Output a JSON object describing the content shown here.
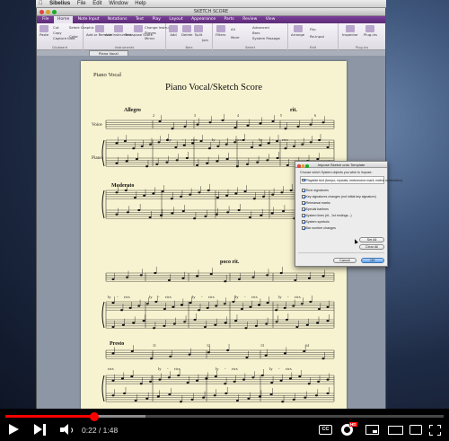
{
  "mac_menubar": {
    "apple": "",
    "items": [
      "Sibelius",
      "File",
      "Edit",
      "Window",
      "Help"
    ]
  },
  "window": {
    "title": "SKETCH SCORE"
  },
  "ribbon": {
    "tabs": [
      "File",
      "Home",
      "Note Input",
      "Notations",
      "Text",
      "Play",
      "Layout",
      "Appearance",
      "Parts",
      "Review",
      "View"
    ],
    "active_tab": "Home",
    "groups": [
      {
        "label": "Clipboard",
        "buttons": [
          "Paste",
          "Cut",
          "Copy",
          "Capture Idea",
          "Select Graphic",
          "Color"
        ]
      },
      {
        "label": "Instruments",
        "buttons": [
          "Add or Remove",
          "Add Instrument",
          "Transpose Score",
          "Change Instrument",
          "Staves",
          "Mirror"
        ]
      },
      {
        "label": "Bars",
        "buttons": [
          "Add",
          "Delete",
          "Split",
          "Join"
        ]
      },
      {
        "label": "Select",
        "buttons": [
          "Filters",
          "All",
          "More",
          "Advanced",
          "Bars",
          "System Passage"
        ]
      },
      {
        "label": "Edit",
        "buttons": [
          "Arrange",
          "Flip",
          "Re-Input"
        ]
      },
      {
        "label": "Plug-ins",
        "buttons": [
          "Inspector",
          "Plug-ins"
        ]
      }
    ]
  },
  "document_tab": "Piano Vocal",
  "score": {
    "part_name": "Piano Vocal",
    "title": "Piano Vocal/Sketch Score",
    "tempos": [
      "Allegro",
      "Moderato",
      "poco rit.",
      "Presto"
    ],
    "rit": "rit.",
    "instruments": [
      "Voice",
      "Piano"
    ],
    "measure_numbers_sys1": [
      "2",
      "3",
      "4",
      "5",
      "6"
    ],
    "measure_numbers_sys4": [
      "11",
      "12",
      "13",
      "14"
    ],
    "lyrics_sys1": [
      "Ly",
      "-",
      "rics",
      "ly",
      "-",
      "rics",
      "ly",
      "-",
      "rics"
    ],
    "lyrics_sys3": [
      "ly",
      "-",
      "rics",
      "ly",
      "-",
      "rics",
      "ly",
      "-",
      "rics",
      "ly",
      "-",
      "rics",
      "ly",
      "-",
      "rics"
    ],
    "lyrics_sys4": [
      "rics",
      "ly",
      "-",
      "rics",
      "ly",
      "-",
      "rics",
      "ly",
      "-",
      "rics"
    ]
  },
  "dialog": {
    "title": "Impose Sketch onto Template",
    "intro": "Choose which System objects you wish to impose:",
    "checkbox_1": "Playable text (tempo, repeats, metronome mark, metric modulation)",
    "options": [
      {
        "label": "Time signatures",
        "checked": true
      },
      {
        "label": "Key signatures changes (not initial key signature)",
        "checked": true
      },
      {
        "label": "Rehearsal marks",
        "checked": true
      },
      {
        "label": "Special barlines",
        "checked": true
      },
      {
        "label": "System lines (rit., 1st endings...)",
        "checked": true
      },
      {
        "label": "System symbols",
        "checked": true
      },
      {
        "label": "Bar number changes",
        "checked": true
      }
    ],
    "set_all": "Set All",
    "clear_all": "Clear All",
    "cancel": "Cancel",
    "ok": "OK"
  },
  "player": {
    "current_time": "0:22",
    "separator": " / ",
    "duration": "1:48",
    "progress_fraction": 0.2037,
    "buffered_fraction": 0.32,
    "cc_label": "CC",
    "hd_label": "HD"
  }
}
